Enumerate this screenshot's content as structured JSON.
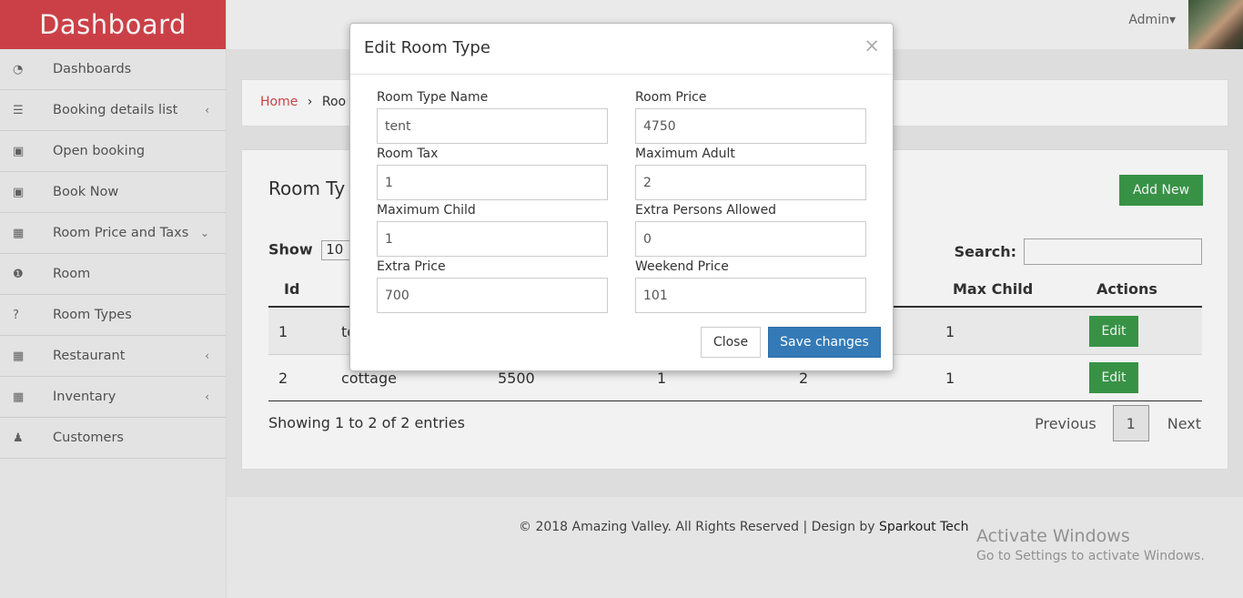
{
  "sidebar": {
    "brand": "Dashboard",
    "items": [
      {
        "label": "Dashboards",
        "icon": "tachometer-icon",
        "glyph": "◔",
        "arrow": ""
      },
      {
        "label": "Booking details list",
        "icon": "list-icon",
        "glyph": "☰",
        "arrow": "‹"
      },
      {
        "label": "Open booking",
        "icon": "image-icon",
        "glyph": "▣",
        "arrow": ""
      },
      {
        "label": "Book Now",
        "icon": "image-icon",
        "glyph": "▣",
        "arrow": ""
      },
      {
        "label": "Room Price and Taxs",
        "icon": "grid-icon",
        "glyph": "▦",
        "arrow": "⌄"
      },
      {
        "label": "Room",
        "icon": "info-icon",
        "glyph": "❶",
        "arrow": ""
      },
      {
        "label": "Room Types",
        "icon": "question-icon",
        "glyph": "?",
        "arrow": ""
      },
      {
        "label": "Restaurant",
        "icon": "grid-icon",
        "glyph": "▦",
        "arrow": "‹"
      },
      {
        "label": "Inventary",
        "icon": "grid-icon",
        "glyph": "▦",
        "arrow": "‹"
      },
      {
        "label": "Customers",
        "icon": "users-icon",
        "glyph": "♟",
        "arrow": ""
      }
    ]
  },
  "topbar": {
    "user": "Admin▾"
  },
  "breadcrumb": {
    "home": "Home",
    "separator": "›",
    "current": "Roo"
  },
  "panel": {
    "title": "Room Ty",
    "add_new": "Add New",
    "show_label": "Show",
    "show_value": "10",
    "search_label": "Search:",
    "columns": [
      "Id",
      "Max Child",
      "Actions"
    ],
    "rows": [
      {
        "id": "1",
        "name": "te",
        "price": "",
        "tax": "",
        "adult": "",
        "child": "1",
        "action": "Edit"
      },
      {
        "id": "2",
        "name": "cottage",
        "price": "5500",
        "tax": "1",
        "adult": "2",
        "child": "1",
        "action": "Edit"
      }
    ],
    "entries": "Showing 1 to 2 of 2 entries",
    "pager": {
      "previous": "Previous",
      "page": "1",
      "next": "Next"
    }
  },
  "footer": {
    "copyright": "© 2018 Amazing Valley. All Rights Reserved | Design by ",
    "designer": "Sparkout Tech",
    "watermark_title": "Activate Windows",
    "watermark_sub": "Go to Settings to activate Windows."
  },
  "modal": {
    "title": "Edit Room Type",
    "close_x": "×",
    "fields": {
      "room_type_name": {
        "label": "Room Type Name",
        "value": "tent"
      },
      "room_price": {
        "label": "Room Price",
        "value": "4750"
      },
      "room_tax": {
        "label": "Room Tax",
        "value": "1"
      },
      "max_adult": {
        "label": "Maximum Adult",
        "value": "2"
      },
      "max_child": {
        "label": "Maximum Child",
        "value": "1"
      },
      "extra_persons": {
        "label": "Extra Persons Allowed",
        "value": "0"
      },
      "extra_price": {
        "label": "Extra Price",
        "value": "700"
      },
      "weekend_price": {
        "label": "Weekend Price",
        "value": "101"
      }
    },
    "close_button": "Close",
    "save_button": "Save changes"
  },
  "colors": {
    "brand": "#d6444b",
    "success": "#3c9a4a",
    "primary": "#337ab7"
  }
}
